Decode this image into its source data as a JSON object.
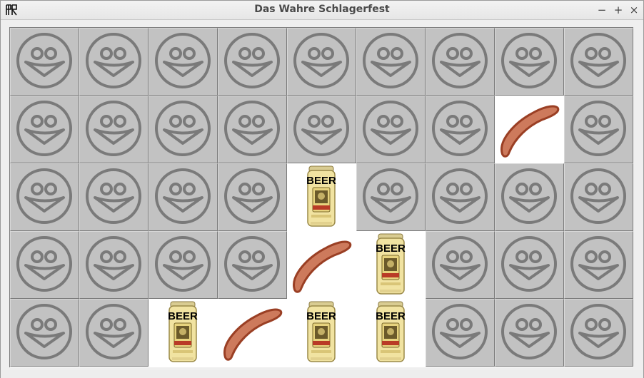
{
  "window": {
    "title": "Das Wahre Schlagerfest",
    "controls": {
      "minimize": "−",
      "maximize": "+",
      "close": "×"
    }
  },
  "beer_label": "BEER",
  "grid": {
    "rows": 5,
    "cols": 9,
    "cells": [
      [
        "smiley",
        "smiley",
        "smiley",
        "smiley",
        "smiley",
        "smiley",
        "smiley",
        "smiley",
        "smiley"
      ],
      [
        "smiley",
        "smiley",
        "smiley",
        "smiley",
        "smiley",
        "smiley",
        "smiley",
        "sausage",
        "smiley"
      ],
      [
        "smiley",
        "smiley",
        "smiley",
        "smiley",
        "beer",
        "smiley",
        "smiley",
        "smiley",
        "smiley"
      ],
      [
        "smiley",
        "smiley",
        "smiley",
        "smiley",
        "sausage",
        "beer",
        "smiley",
        "smiley",
        "smiley"
      ],
      [
        "smiley",
        "smiley",
        "beer",
        "sausage",
        "beer",
        "beer",
        "smiley",
        "smiley",
        "smiley"
      ]
    ]
  },
  "icons": {
    "hidden_tile": "smiley-icon",
    "beer": "beer-can-icon",
    "sausage": "sausage-icon",
    "app": "app-logo-icon"
  },
  "colors": {
    "tile": "#c2c2c2",
    "smiley": "#7a7a7a",
    "sausage_fill": "#cd7a5c",
    "sausage_stroke": "#9a3f24",
    "can": "#f1e3a1",
    "beer_text": "#000000"
  }
}
